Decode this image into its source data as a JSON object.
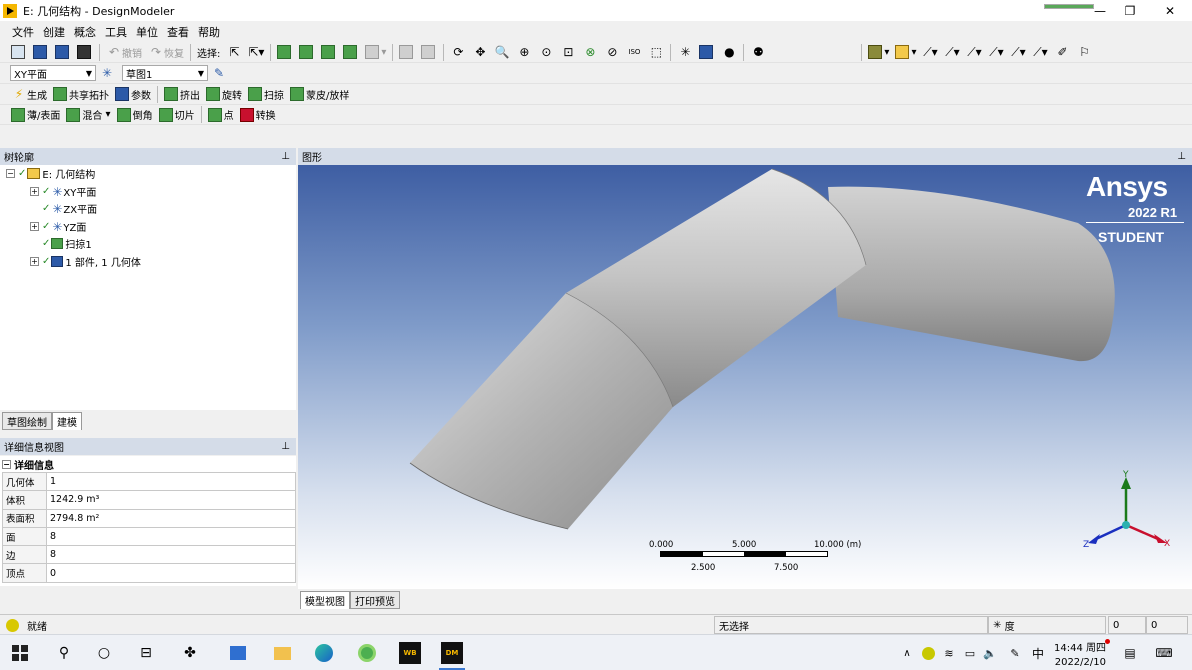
{
  "window": {
    "title": "E: 几何结构 - DesignModeler",
    "app_icon": "designmodeler-icon",
    "progress_fraction": 1.0,
    "minimize_glyph": "—",
    "restore_glyph": "❐",
    "close_glyph": "✕"
  },
  "menubar": [
    "文件",
    "创建",
    "概念",
    "工具",
    "单位",
    "查看",
    "帮助"
  ],
  "toolbar1": {
    "undo": "撤销",
    "redo": "恢复",
    "select_label": "选择:"
  },
  "toolbar2": {
    "plane_combo": "XY平面",
    "sketch_combo": "草图1"
  },
  "toolbar3": {
    "generate": "生成",
    "share_topology": "共享拓扑",
    "parameters": "参数",
    "extrude": "挤出",
    "revolve": "旋转",
    "sweep": "扫掠",
    "skin_loft": "蒙皮/放样"
  },
  "toolbar4": {
    "thin_surface": "薄/表面",
    "blend": "混合",
    "chamfer": "倒角",
    "slice": "切片",
    "point": "点",
    "conversion": "转换"
  },
  "tree": {
    "header": "树轮廓",
    "pin": "ꟸ",
    "root": "E: 几何结构",
    "items": [
      {
        "label": "XY平面",
        "expandable": true
      },
      {
        "label": "ZX平面",
        "expandable": false
      },
      {
        "label": "YZ面",
        "expandable": true
      },
      {
        "label": "扫掠1",
        "expandable": false
      },
      {
        "label": "1 部件, 1 几何体",
        "expandable": true
      }
    ]
  },
  "left_tabs": [
    "草图绘制",
    "建模"
  ],
  "details": {
    "header": "详细信息视图",
    "section": "详细信息",
    "rows": [
      {
        "key": "几何体",
        "value": "1"
      },
      {
        "key": "体积",
        "value": "1242.9 m³"
      },
      {
        "key": "表面积",
        "value": "2794.8 m²"
      },
      {
        "key": "面",
        "value": "8"
      },
      {
        "key": "边",
        "value": "8"
      },
      {
        "key": "顶点",
        "value": "0"
      }
    ]
  },
  "graphics": {
    "header": "图形",
    "brand": "Ansys",
    "version": "2022 R1",
    "edition": "STUDENT",
    "scale_labels_top": [
      "0.000",
      "5.000",
      "10.000 (m)"
    ],
    "scale_labels_bottom": [
      "2.500",
      "7.500"
    ],
    "axes": {
      "x": "X",
      "y": "Y",
      "z": "Z"
    },
    "colors": {
      "x": "#c8102e",
      "y": "#1a7a1a",
      "z": "#1a2fbf"
    }
  },
  "bottom_tabs": [
    "模型视图",
    "打印预览"
  ],
  "status": {
    "ready": "就绪",
    "selection": "无选择",
    "unit_icon": "✳",
    "unit": "度",
    "c1": "0",
    "c2": "0"
  },
  "taskbar": {
    "icons": [
      "windows-start-icon",
      "search-icon",
      "cortana-icon",
      "task-view-icon",
      "ansys-icon",
      "store-icon",
      "file-explorer-icon",
      "edge-icon",
      "chrome-icon",
      "workbench-icon",
      "designmodeler-icon"
    ],
    "workbench_label": "WB",
    "dm_label": "DM",
    "tray_ime": "中",
    "time": "14:44 周四",
    "date": "2022/2/10"
  }
}
